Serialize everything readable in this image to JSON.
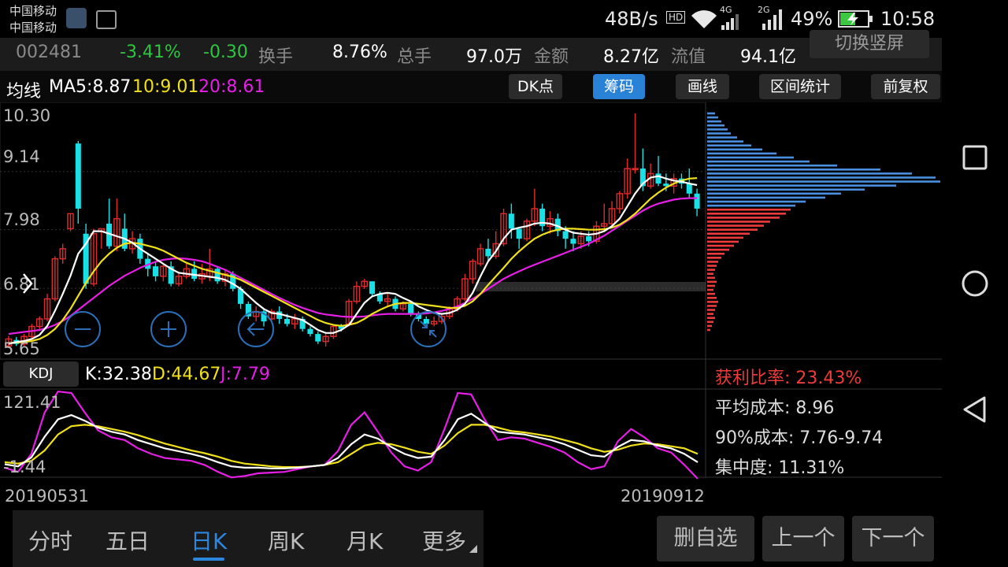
{
  "status_bar": {
    "carrier1": "中国移动",
    "carrier2": "中国移动",
    "net_speed": "48B/s",
    "hd_badge": "HD",
    "net_4g": "4G",
    "net_2g": "2G",
    "battery": "49%",
    "time": "10:58"
  },
  "quote": {
    "code": "002481",
    "change_pct": "-3.41%",
    "change": "-0.30",
    "turnover_label": "换手",
    "turnover": "8.76%",
    "volume_label": "总手",
    "volume": "97.0万",
    "amount_label": "金额",
    "amount": "8.27亿",
    "float_label": "流值",
    "float_value": "94.1亿",
    "switch_label": "切换竖屏"
  },
  "ma_bar": {
    "title": "均线",
    "ma5": "MA5:8.87",
    "ma10": "10:9.01",
    "ma20": "20:8.61",
    "buttons": [
      "DK点",
      "筹码",
      "画线",
      "区间统计",
      "前复权"
    ],
    "active_index": 1
  },
  "main_chart": {
    "y_ticks": [
      "10.30",
      "9.14",
      "7.98",
      "6.81",
      "5.65"
    ],
    "expand_icon": "chevron-right-icon",
    "zoom_out_icon": "minus-icon",
    "zoom_in_icon": "plus-icon",
    "back_icon": "arrow-left-icon",
    "collapse_icon": "shrink-icon"
  },
  "chart_data": {
    "type": "candlestick",
    "ylim": [
      5.65,
      10.3
    ],
    "candles": [
      [
        5.66,
        5.8,
        5.62,
        5.86
      ],
      [
        5.78,
        5.7,
        5.66,
        5.84
      ],
      [
        5.7,
        5.85,
        5.66,
        5.9
      ],
      [
        5.85,
        6.05,
        5.8,
        6.1
      ],
      [
        6.05,
        6.2,
        6.0,
        6.25
      ],
      [
        6.2,
        6.6,
        6.15,
        6.7
      ],
      [
        6.6,
        7.4,
        6.55,
        7.45
      ],
      [
        7.4,
        7.6,
        7.3,
        7.7
      ],
      [
        8.0,
        8.3,
        7.95,
        8.3
      ],
      [
        9.7,
        8.4,
        8.1,
        9.75
      ],
      [
        7.9,
        6.9,
        6.8,
        8.1
      ],
      [
        6.9,
        7.9,
        6.85,
        8.0
      ],
      [
        7.95,
        8.0,
        7.6,
        8.0
      ],
      [
        8.1,
        7.65,
        7.6,
        8.6
      ],
      [
        7.65,
        8.2,
        7.55,
        8.6
      ],
      [
        8.0,
        7.6,
        7.55,
        8.3
      ],
      [
        7.6,
        7.8,
        7.5,
        7.95
      ],
      [
        7.8,
        7.4,
        7.3,
        7.9
      ],
      [
        7.4,
        7.2,
        7.05,
        7.5
      ],
      [
        7.25,
        7.05,
        6.95,
        7.35
      ],
      [
        7.05,
        7.25,
        6.95,
        7.3
      ],
      [
        7.25,
        6.9,
        6.85,
        7.35
      ],
      [
        6.9,
        7.05,
        6.85,
        7.1
      ],
      [
        7.05,
        7.2,
        7.0,
        7.3
      ],
      [
        7.2,
        7.0,
        6.95,
        7.35
      ],
      [
        7.0,
        7.1,
        6.9,
        7.3
      ],
      [
        7.05,
        7.2,
        6.95,
        7.6
      ],
      [
        7.2,
        6.95,
        6.9,
        7.25
      ],
      [
        6.95,
        7.1,
        6.85,
        7.2
      ],
      [
        7.1,
        6.8,
        6.75,
        7.15
      ],
      [
        6.8,
        6.5,
        6.4,
        6.85
      ],
      [
        6.5,
        6.25,
        6.2,
        6.55
      ],
      [
        6.25,
        6.35,
        6.15,
        6.45
      ],
      [
        6.35,
        6.15,
        6.05,
        6.4
      ],
      [
        6.2,
        6.35,
        6.15,
        6.4
      ],
      [
        6.35,
        6.2,
        6.1,
        6.45
      ],
      [
        6.2,
        6.1,
        6.05,
        6.3
      ],
      [
        6.1,
        6.2,
        6.0,
        6.3
      ],
      [
        6.2,
        6.0,
        5.95,
        6.25
      ],
      [
        6.0,
        5.9,
        5.85,
        6.05
      ],
      [
        5.9,
        5.75,
        5.7,
        5.95
      ],
      [
        5.75,
        5.85,
        5.65,
        5.9
      ],
      [
        5.85,
        6.05,
        5.8,
        6.1
      ],
      [
        6.05,
        6.0,
        5.95,
        6.1
      ],
      [
        6.1,
        6.55,
        6.05,
        6.6
      ],
      [
        6.55,
        6.85,
        6.5,
        6.95
      ],
      [
        6.85,
        6.95,
        6.8,
        7.0
      ],
      [
        6.95,
        6.7,
        6.65,
        6.95
      ],
      [
        6.7,
        6.55,
        6.5,
        6.75
      ],
      [
        6.55,
        6.6,
        6.45,
        6.7
      ],
      [
        6.6,
        6.4,
        6.35,
        6.65
      ],
      [
        6.4,
        6.5,
        6.35,
        6.55
      ],
      [
        6.5,
        6.3,
        6.25,
        6.55
      ],
      [
        6.3,
        6.2,
        6.15,
        6.35
      ],
      [
        6.2,
        6.1,
        6.05,
        6.25
      ],
      [
        6.1,
        6.15,
        6.05,
        6.25
      ],
      [
        6.15,
        6.25,
        6.1,
        6.3
      ],
      [
        6.25,
        6.4,
        6.2,
        6.45
      ],
      [
        6.4,
        6.6,
        6.35,
        6.65
      ],
      [
        6.6,
        7.0,
        6.55,
        7.1
      ],
      [
        7.0,
        7.35,
        6.9,
        7.4
      ],
      [
        7.3,
        7.6,
        7.25,
        7.7
      ],
      [
        7.6,
        7.45,
        7.35,
        7.8
      ],
      [
        7.45,
        7.7,
        7.4,
        7.95
      ],
      [
        7.7,
        8.3,
        7.65,
        8.4
      ],
      [
        8.3,
        8.0,
        7.8,
        8.5
      ],
      [
        8.0,
        7.8,
        7.6,
        8.0
      ],
      [
        7.8,
        8.15,
        7.75,
        8.2
      ],
      [
        8.15,
        8.4,
        8.05,
        8.8
      ],
      [
        8.4,
        8.05,
        7.95,
        8.5
      ],
      [
        8.05,
        8.2,
        7.9,
        8.35
      ],
      [
        8.2,
        7.95,
        7.85,
        8.3
      ],
      [
        7.95,
        7.8,
        7.6,
        8.05
      ],
      [
        7.8,
        7.7,
        7.55,
        7.95
      ],
      [
        7.7,
        7.85,
        7.6,
        7.95
      ],
      [
        7.85,
        7.75,
        7.65,
        7.95
      ],
      [
        7.75,
        8.05,
        7.7,
        8.15
      ],
      [
        8.05,
        8.1,
        7.95,
        8.5
      ],
      [
        8.1,
        8.4,
        8.05,
        8.55
      ],
      [
        8.4,
        8.7,
        8.3,
        8.75
      ],
      [
        8.7,
        9.2,
        8.6,
        9.4
      ],
      [
        9.2,
        9.2,
        9.1,
        10.3
      ],
      [
        9.2,
        8.85,
        8.75,
        9.6
      ],
      [
        8.85,
        9.1,
        8.8,
        9.3
      ],
      [
        9.1,
        8.9,
        8.85,
        9.45
      ],
      [
        8.9,
        8.85,
        8.75,
        9.1
      ],
      [
        8.85,
        9.0,
        8.7,
        9.1
      ],
      [
        9.0,
        8.9,
        8.8,
        9.1
      ],
      [
        8.9,
        8.7,
        8.6,
        9.2
      ],
      [
        8.7,
        8.4,
        8.25,
        8.8
      ]
    ],
    "ma5": [
      5.7,
      5.74,
      5.76,
      5.8,
      5.88,
      6.06,
      6.36,
      6.7,
      7.06,
      7.5,
      7.7,
      7.95,
      7.95,
      7.9,
      7.85,
      7.8,
      7.72,
      7.6,
      7.5,
      7.4,
      7.3,
      7.2,
      7.12,
      7.1,
      7.08,
      7.06,
      7.04,
      7.02,
      6.98,
      6.9,
      6.8,
      6.66,
      6.52,
      6.4,
      6.32,
      6.3,
      6.26,
      6.22,
      6.18,
      6.08,
      5.98,
      5.92,
      5.92,
      5.98,
      6.08,
      6.3,
      6.52,
      6.65,
      6.7,
      6.72,
      6.7,
      6.62,
      6.55,
      6.45,
      6.38,
      6.32,
      6.3,
      6.32,
      6.38,
      6.5,
      6.72,
      7.05,
      7.35,
      7.55,
      7.8,
      7.98,
      8.02,
      8.05,
      8.1,
      8.12,
      8.1,
      8.05,
      7.98,
      7.92,
      7.9,
      7.88,
      7.9,
      7.95,
      8.05,
      8.2,
      8.45,
      8.7,
      8.9,
      9.02,
      9.05,
      9.0,
      8.96,
      8.94,
      8.9,
      8.87
    ],
    "ma10": [
      5.72,
      5.73,
      5.74,
      5.76,
      5.8,
      5.88,
      6.0,
      6.18,
      6.4,
      6.66,
      6.92,
      7.15,
      7.35,
      7.5,
      7.62,
      7.7,
      7.72,
      7.7,
      7.66,
      7.62,
      7.56,
      7.48,
      7.4,
      7.32,
      7.26,
      7.2,
      7.16,
      7.12,
      7.08,
      7.04,
      6.98,
      6.9,
      6.82,
      6.74,
      6.66,
      6.58,
      6.5,
      6.42,
      6.34,
      6.26,
      6.18,
      6.12,
      6.08,
      6.06,
      6.08,
      6.12,
      6.2,
      6.3,
      6.38,
      6.45,
      6.5,
      6.52,
      6.52,
      6.5,
      6.48,
      6.46,
      6.44,
      6.42,
      6.42,
      6.46,
      6.55,
      6.7,
      6.88,
      7.05,
      7.22,
      7.4,
      7.55,
      7.68,
      7.8,
      7.88,
      7.94,
      7.98,
      8.0,
      8.0,
      7.99,
      7.98,
      7.98,
      7.99,
      8.02,
      8.08,
      8.18,
      8.3,
      8.45,
      8.6,
      8.72,
      8.82,
      8.9,
      8.96,
      9.0,
      9.01
    ],
    "ma20": [
      5.9,
      5.92,
      5.94,
      5.96,
      5.98,
      6.02,
      6.08,
      6.16,
      6.26,
      6.38,
      6.5,
      6.62,
      6.74,
      6.86,
      6.96,
      7.06,
      7.14,
      7.22,
      7.28,
      7.34,
      7.38,
      7.4,
      7.41,
      7.4,
      7.38,
      7.35,
      7.3,
      7.24,
      7.18,
      7.1,
      7.02,
      6.94,
      6.86,
      6.78,
      6.7,
      6.62,
      6.55,
      6.48,
      6.42,
      6.37,
      6.32,
      6.29,
      6.27,
      6.25,
      6.24,
      6.24,
      6.25,
      6.27,
      6.29,
      6.3,
      6.3,
      6.3,
      6.3,
      6.3,
      6.31,
      6.33,
      6.36,
      6.4,
      6.45,
      6.52,
      6.6,
      6.7,
      6.8,
      6.9,
      7.0,
      7.08,
      7.15,
      7.22,
      7.28,
      7.34,
      7.4,
      7.46,
      7.52,
      7.58,
      7.64,
      7.7,
      7.78,
      7.86,
      7.96,
      8.06,
      8.16,
      8.26,
      8.36,
      8.44,
      8.5,
      8.54,
      8.58,
      8.6,
      8.61,
      8.61
    ],
    "chip_distribution": {
      "current_price": 8.4,
      "profit_color": "#ee3b3b",
      "loss_color": "#4a8fe0",
      "bins": [
        [
          10.3,
          10
        ],
        [
          10.22,
          14
        ],
        [
          10.14,
          18
        ],
        [
          10.06,
          22
        ],
        [
          9.98,
          26
        ],
        [
          9.9,
          30
        ],
        [
          9.82,
          38
        ],
        [
          9.74,
          46
        ],
        [
          9.66,
          56
        ],
        [
          9.58,
          70
        ],
        [
          9.5,
          88
        ],
        [
          9.42,
          110
        ],
        [
          9.34,
          130
        ],
        [
          9.26,
          165
        ],
        [
          9.18,
          220
        ],
        [
          9.1,
          260
        ],
        [
          9.02,
          290
        ],
        [
          8.94,
          296
        ],
        [
          8.86,
          240
        ],
        [
          8.78,
          200
        ],
        [
          8.7,
          170
        ],
        [
          8.62,
          150
        ],
        [
          8.54,
          125
        ],
        [
          8.46,
          112
        ],
        [
          8.38,
          106
        ],
        [
          8.3,
          100
        ],
        [
          8.22,
          92
        ],
        [
          8.14,
          80
        ],
        [
          8.06,
          72
        ],
        [
          7.98,
          64
        ],
        [
          7.9,
          54
        ],
        [
          7.82,
          46
        ],
        [
          7.74,
          40
        ],
        [
          7.66,
          34
        ],
        [
          7.58,
          28
        ],
        [
          7.5,
          22
        ],
        [
          7.42,
          18
        ],
        [
          7.34,
          14
        ],
        [
          7.26,
          12
        ],
        [
          7.18,
          10
        ],
        [
          7.1,
          8
        ],
        [
          7.02,
          10
        ],
        [
          6.94,
          12
        ],
        [
          6.86,
          10
        ],
        [
          6.78,
          8
        ],
        [
          6.7,
          10
        ],
        [
          6.62,
          12
        ],
        [
          6.54,
          14
        ],
        [
          6.46,
          12
        ],
        [
          6.38,
          10
        ],
        [
          6.3,
          8
        ],
        [
          6.22,
          10
        ],
        [
          6.14,
          8
        ],
        [
          6.06,
          6
        ],
        [
          5.98,
          4
        ]
      ]
    },
    "kdj": {
      "K": [
        15,
        12,
        25,
        55,
        80,
        86,
        78,
        68,
        62,
        58,
        50,
        44,
        38,
        34,
        30,
        25,
        18,
        12,
        10,
        10,
        9,
        9,
        10,
        12,
        14,
        24,
        44,
        58,
        52,
        40,
        30,
        24,
        26,
        50,
        80,
        88,
        75,
        62,
        60,
        58,
        54,
        50,
        44,
        36,
        28,
        26,
        40,
        50,
        48,
        42,
        38,
        30,
        18
      ],
      "D": [
        18,
        16,
        20,
        35,
        58,
        70,
        72,
        70,
        66,
        62,
        57,
        51,
        45,
        40,
        35,
        31,
        26,
        20,
        16,
        14,
        12,
        11,
        11,
        12,
        14,
        18,
        30,
        42,
        46,
        44,
        39,
        33,
        30,
        42,
        60,
        72,
        72,
        68,
        63,
        61,
        58,
        55,
        50,
        45,
        38,
        33,
        36,
        42,
        45,
        44,
        41,
        38,
        30
      ],
      "J": [
        10,
        4,
        30,
        90,
        120,
        118,
        90,
        64,
        54,
        50,
        38,
        30,
        24,
        22,
        20,
        14,
        4,
        -4,
        -2,
        2,
        3,
        4,
        8,
        12,
        14,
        34,
        72,
        90,
        62,
        32,
        12,
        6,
        18,
        66,
        118,
        116,
        80,
        50,
        54,
        52,
        46,
        40,
        32,
        18,
        8,
        12,
        48,
        66,
        54,
        38,
        32,
        14,
        -6
      ],
      "ylim": [
        -1.44,
        121.41
      ]
    }
  },
  "kdj_bar": {
    "button": "KDJ",
    "k": "K:32.38",
    "d": "D:44.67",
    "j": "J:7.79",
    "y_top": "121.41",
    "y_bottom": "-1.44"
  },
  "chip_stats": {
    "profit_ratio": "获利比率: 23.43%",
    "avg_cost": "平均成本: 8.96",
    "cost90": "90%成本: 7.76-9.74",
    "concentration": "集中度: 11.31%"
  },
  "dates": {
    "start": "20190531",
    "end": "20190912"
  },
  "tabs": {
    "items": [
      "分时",
      "五日",
      "日K",
      "周K",
      "月K",
      "更多"
    ],
    "active_index": 2
  },
  "bottom_buttons": {
    "remove": "删自选",
    "prev": "上一个",
    "next": "下一个"
  },
  "colors": {
    "rise": "#e12b2b",
    "fall": "#19e0e6",
    "ma5": "#ffffff",
    "ma10": "#f0e11a",
    "ma20": "#e61ee6",
    "active_blue": "#2a82d7"
  }
}
